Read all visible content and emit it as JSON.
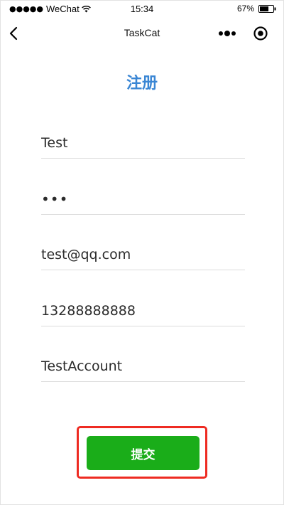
{
  "status_bar": {
    "signal_dots": "●●●●●",
    "carrier": "WeChat",
    "time": "15:34",
    "battery_percent": "67%",
    "battery_level": 0.67
  },
  "nav_bar": {
    "title": "TaskCat",
    "back_icon": "chevron-left-icon",
    "more_icon": "more-dots-icon",
    "close_icon": "target-circle-icon"
  },
  "form": {
    "title": "注册",
    "username": "Test",
    "password": "•••",
    "email": "test@qq.com",
    "phone": "13288888888",
    "account": "TestAccount",
    "submit_label": "提交"
  },
  "colors": {
    "title_blue": "#3a86d4",
    "submit_green": "#1aad19",
    "highlight_red": "#ee2b22"
  }
}
